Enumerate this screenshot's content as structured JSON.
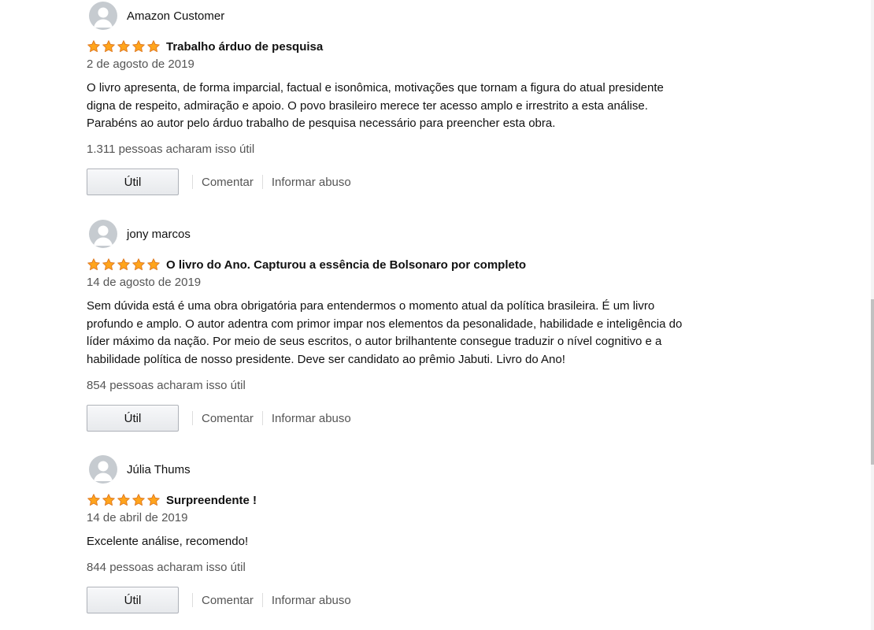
{
  "reviews": [
    {
      "reviewer": "Amazon Customer",
      "rating": 5,
      "title": "Trabalho árduo de pesquisa",
      "date": "2 de agosto de 2019",
      "body_lines": [
        "O livro apresenta, de forma imparcial, factual e isonômica, motivações que tornam a figura do atual presidente",
        "digna de respeito, admiração e apoio. O povo brasileiro merece ter acesso amplo e irrestrito a esta análise.",
        "Parabéns ao autor pelo árduo trabalho de pesquisa necessário para preencher esta obra."
      ],
      "helpful": "1.311 pessoas acharam isso útil",
      "util_label": "Útil",
      "comment_label": "Comentar",
      "report_label": "Informar abuso"
    },
    {
      "reviewer": "jony marcos",
      "rating": 5,
      "title": "O livro do Ano. Capturou a essência de Bolsonaro por completo",
      "date": "14 de agosto de 2019",
      "body_lines": [
        "Sem dúvida está é uma obra obrigatória para entendermos o momento atual da política brasileira. É um livro",
        "profundo e amplo. O autor adentra com primor impar nos elementos da pesonalidade, habilidade e inteligência do",
        "líder máximo da nação. Por meio de seus escritos, o autor brilhantente consegue traduzir o nível cognitivo e a",
        "habilidade política de nosso presidente. Deve ser candidato ao prêmio Jabuti. Livro do Ano!"
      ],
      "helpful": "854 pessoas acharam isso útil",
      "util_label": "Útil",
      "comment_label": "Comentar",
      "report_label": "Informar abuso"
    },
    {
      "reviewer": "Júlia Thums",
      "rating": 5,
      "title": "Surpreendente !",
      "date": "14 de abril de 2019",
      "body_lines": [
        "Excelente análise, recomendo!"
      ],
      "helpful": "844 pessoas acharam isso útil",
      "util_label": "Útil",
      "comment_label": "Comentar",
      "report_label": "Informar abuso"
    }
  ],
  "colors": {
    "star_fill": "#ffa41c",
    "star_stroke": "#de7921",
    "muted_text": "#555555",
    "avatar_bg": "#c6cbd0"
  },
  "icons": {
    "avatar": "default-user-avatar-icon",
    "star": "star-icon"
  }
}
